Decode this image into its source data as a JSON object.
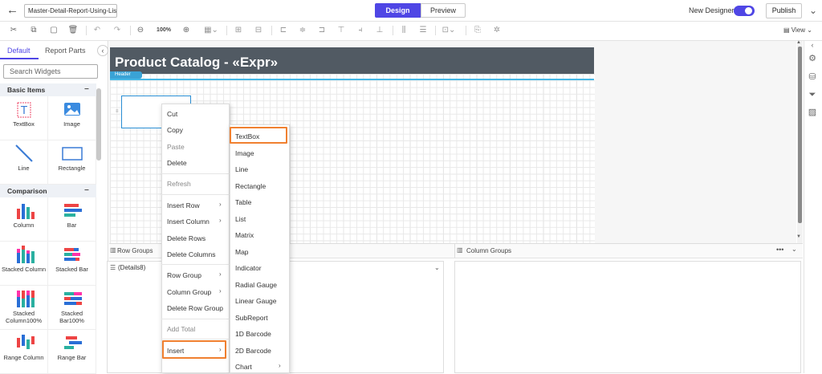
{
  "header": {
    "back": "←",
    "report_name": "Master-Detail-Report-Using-Lis",
    "tab_design": "Design",
    "tab_preview": "Preview",
    "new_designer_label": "New Designer",
    "publish": "Publish",
    "more": "⌄"
  },
  "toolbar": {
    "zoom": "100%",
    "view": "View"
  },
  "left_panel": {
    "tab_default": "Default",
    "tab_parts": "Report Parts",
    "collapse": "‹",
    "search_placeholder": "Search Widgets",
    "sections": [
      {
        "title": "Basic Items",
        "collapse": "−"
      },
      {
        "title": "Comparison",
        "collapse": "−"
      }
    ],
    "basic_items": [
      "TextBox",
      "Image",
      "Line",
      "Rectangle"
    ],
    "comparison_items": [
      "Column",
      "Bar",
      "Stacked Column",
      "Stacked Bar",
      "Stacked Column100%",
      "Stacked Bar100%",
      "Range Column",
      "Range Bar"
    ]
  },
  "canvas": {
    "report_title": "Product Catalog - «Expr»",
    "header_tag": "Header"
  },
  "groups": {
    "row_groups": "Row Groups",
    "column_groups": "Column Groups",
    "row_item": "(Details8)",
    "more": "•••",
    "expand": "⌄"
  },
  "context_menu": {
    "items": [
      "Cut",
      "Copy",
      "Paste",
      "Delete",
      "Refresh",
      "Insert Row",
      "Insert Column",
      "Delete Rows",
      "Delete Columns",
      "Row Group",
      "Column Group",
      "Delete Row Group",
      "Add Total",
      "Insert"
    ]
  },
  "insert_submenu": {
    "items": [
      "TextBox",
      "Image",
      "Line",
      "Rectangle",
      "Table",
      "List",
      "Matrix",
      "Map",
      "Indicator",
      "Radial Gauge",
      "Linear Gauge",
      "SubReport",
      "1D Barcode",
      "2D Barcode",
      "Chart"
    ]
  },
  "colors": {
    "accent": "#4f46e5",
    "highlight": "#f08030",
    "header_band": "#515a63",
    "header_line": "#46b8e6"
  }
}
